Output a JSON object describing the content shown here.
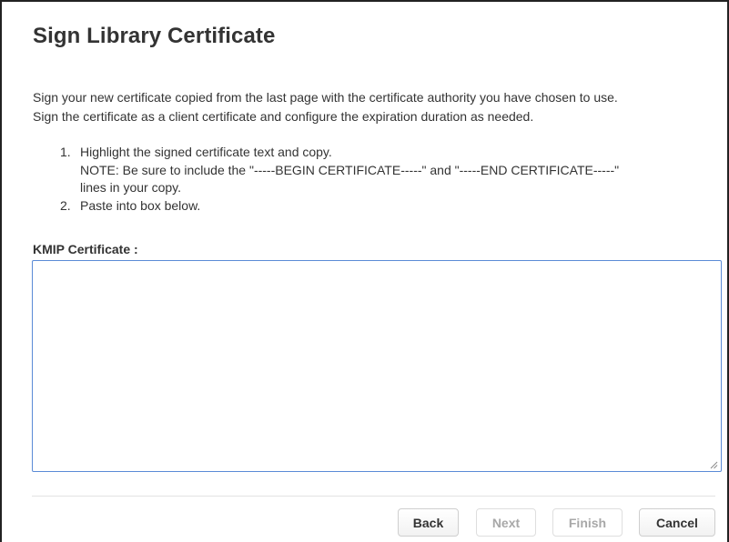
{
  "dialog": {
    "title": "Sign Library Certificate",
    "intro_line_1": "Sign your new certificate copied from the last page with the certificate authority you have chosen to use.",
    "intro_line_2": "Sign the certificate as a client certificate and configure the expiration duration as needed.",
    "steps": [
      {
        "number": "1.",
        "lines": [
          "Highlight the signed certificate text and copy.",
          "NOTE: Be sure to include the \"-----BEGIN CERTIFICATE-----\" and \"-----END CERTIFICATE-----\"",
          "lines in your copy."
        ]
      },
      {
        "number": "2.",
        "lines": [
          "Paste into box below."
        ]
      }
    ],
    "field_label": "KMIP Certificate :",
    "certificate_value": "",
    "certificate_placeholder": ""
  },
  "buttons": {
    "back": "Back",
    "next": "Next",
    "finish": "Finish",
    "cancel": "Cancel"
  },
  "states": {
    "back_enabled": true,
    "next_enabled": false,
    "finish_enabled": false,
    "cancel_enabled": true
  },
  "colors": {
    "textarea_border": "#5b8bd6",
    "disabled_text": "#a8a8a8",
    "text": "#333333"
  },
  "icons": {
    "resize_grip": "resize-grip-icon"
  }
}
